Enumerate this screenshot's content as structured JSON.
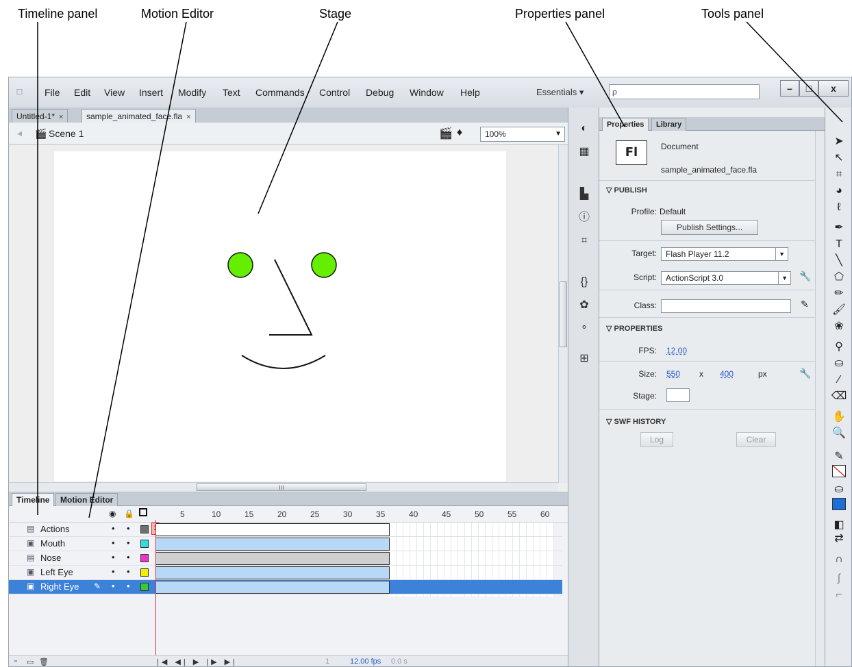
{
  "callouts": {
    "timeline_panel": "Timeline panel",
    "motion_editor": "Motion Editor",
    "stage": "Stage",
    "properties_panel": "Properties panel",
    "tools_panel": "Tools panel"
  },
  "menu": {
    "items": [
      "File",
      "Edit",
      "View",
      "Insert",
      "Modify",
      "Text",
      "Commands",
      "Control",
      "Debug",
      "Window",
      "Help"
    ],
    "workspace": "Essentials ▾",
    "search_placeholder": "ρ"
  },
  "window_buttons": {
    "minimize": "–",
    "maximize": "□",
    "close": "x"
  },
  "doc_tabs": [
    {
      "label": "Untitled-1*",
      "close": "×"
    },
    {
      "label": "sample_animated_face.fla",
      "close": "×"
    }
  ],
  "scene": {
    "label": "Scene 1",
    "zoom": "100%"
  },
  "stage": {
    "bg": "#ffffff",
    "eye_color": "#66ee00",
    "stroke_color": "#111111"
  },
  "timeline": {
    "tabs": [
      "Timeline",
      "Motion Editor"
    ],
    "frame_numbers": [
      "1",
      "5",
      "10",
      "15",
      "20",
      "25",
      "30",
      "35",
      "40",
      "45",
      "50",
      "55",
      "60"
    ],
    "layers": [
      {
        "name": "Actions",
        "color": "#707070"
      },
      {
        "name": "Mouth",
        "color": "#33dddd"
      },
      {
        "name": "Nose",
        "color": "#ee33cc"
      },
      {
        "name": "Left Eye",
        "color": "#f0f000"
      },
      {
        "name": "Right Eye",
        "color": "#33cc33"
      }
    ],
    "selected_layer": "Right Eye",
    "footer": {
      "current_frame": "1",
      "fps": "12.00 fps",
      "time": "0.0 s"
    }
  },
  "properties": {
    "tabs": [
      "Properties",
      "Library"
    ],
    "doc_type": "Document",
    "doc_name": "sample_animated_face.fla",
    "fl_logo": "Fl",
    "publish": {
      "section": "PUBLISH",
      "profile_label": "Profile:",
      "profile_value": "Default",
      "settings_button": "Publish Settings...",
      "target_label": "Target:",
      "target_value": "Flash Player 11.2",
      "script_label": "Script:",
      "script_value": "ActionScript 3.0",
      "class_label": "Class:"
    },
    "props": {
      "section": "PROPERTIES",
      "fps_label": "FPS:",
      "fps_value": "12.00",
      "size_label": "Size:",
      "width": "550",
      "x": "x",
      "height": "400",
      "unit": "px",
      "stage_label": "Stage:"
    },
    "swf_history": {
      "section": "SWF HISTORY",
      "log_button": "Log",
      "clear_button": "Clear"
    }
  }
}
